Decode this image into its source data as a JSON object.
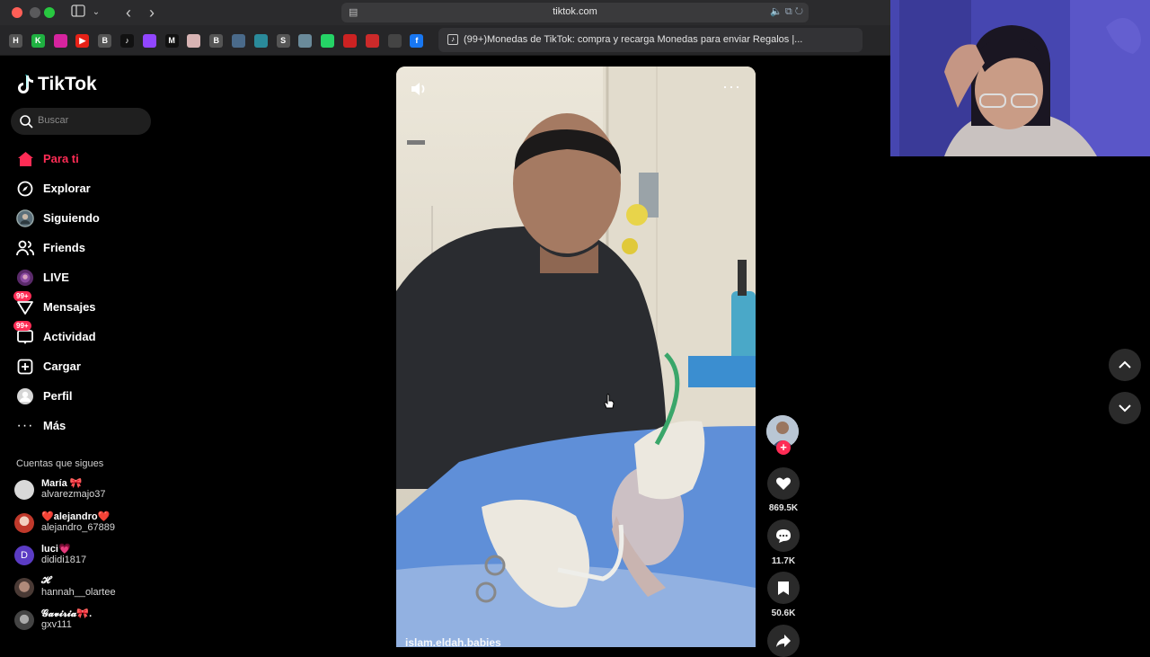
{
  "browser": {
    "url": "tiktok.com",
    "tab_title": "(99+)Monedas de TikTok: compra y recarga Monedas para enviar Regalos |...",
    "favorites": [
      {
        "letter": "H",
        "color": "#555555"
      },
      {
        "letter": "K",
        "color": "#1fb141"
      },
      {
        "letter": "",
        "color": "#d6249f"
      },
      {
        "letter": "▶",
        "color": "#e62117"
      },
      {
        "letter": "B",
        "color": "#555555"
      },
      {
        "letter": "♪",
        "color": "#111111"
      },
      {
        "letter": "",
        "color": "#9146ff"
      },
      {
        "letter": "M",
        "color": "#111111"
      },
      {
        "letter": "",
        "color": "#d8b4b4"
      },
      {
        "letter": "B",
        "color": "#555555"
      },
      {
        "letter": "",
        "color": "#4a6a8a"
      },
      {
        "letter": "",
        "color": "#2a8a9a"
      },
      {
        "letter": "S",
        "color": "#555555"
      },
      {
        "letter": "",
        "color": "#6a8a9a"
      },
      {
        "letter": "",
        "color": "#25d366"
      },
      {
        "letter": "",
        "color": "#cc2222"
      },
      {
        "letter": "",
        "color": "#cc2a2a"
      },
      {
        "letter": "",
        "color": "#444444"
      },
      {
        "letter": "f",
        "color": "#1877f2"
      }
    ]
  },
  "app": {
    "logo_text": "TikTok",
    "search_placeholder": "Buscar",
    "nav": [
      {
        "label": "Para ti",
        "icon": "home-icon",
        "active": true
      },
      {
        "label": "Explorar",
        "icon": "compass-icon"
      },
      {
        "label": "Siguiendo",
        "icon": "following-avatar-icon"
      },
      {
        "label": "Friends",
        "icon": "friends-icon"
      },
      {
        "label": "LIVE",
        "icon": "live-icon"
      },
      {
        "label": "Mensajes",
        "icon": "message-icon",
        "badge": "99+"
      },
      {
        "label": "Actividad",
        "icon": "activity-icon",
        "badge": "99+"
      },
      {
        "label": "Cargar",
        "icon": "upload-icon"
      },
      {
        "label": "Perfil",
        "icon": "profile-icon"
      },
      {
        "label": "Más",
        "icon": "more-icon"
      }
    ],
    "following_title": "Cuentas que sigues",
    "following": [
      {
        "name": "María 🎀",
        "user": "alvarezmajo37",
        "avatar": "#d9d9d9"
      },
      {
        "name": "❤️alejandro❤️",
        "user": "alejandro_67889",
        "avatar": "#c0392b"
      },
      {
        "name": "luci💗",
        "user": "dididi1817",
        "avatar": "#5b3cc4",
        "initial": "D"
      },
      {
        "name": "𝓗",
        "user": "hannah__olartee",
        "avatar": "#6b5a55"
      },
      {
        "name": "𝓖𝓪𝓿𝓲𝓻𝓲𝓪🎀.",
        "user": "gxv111",
        "avatar": "#7a7a7a"
      }
    ]
  },
  "video": {
    "caption": "islam.eldah.babies"
  },
  "actions": {
    "likes": "869.5K",
    "comments": "11.7K",
    "saves": "50.6K"
  }
}
